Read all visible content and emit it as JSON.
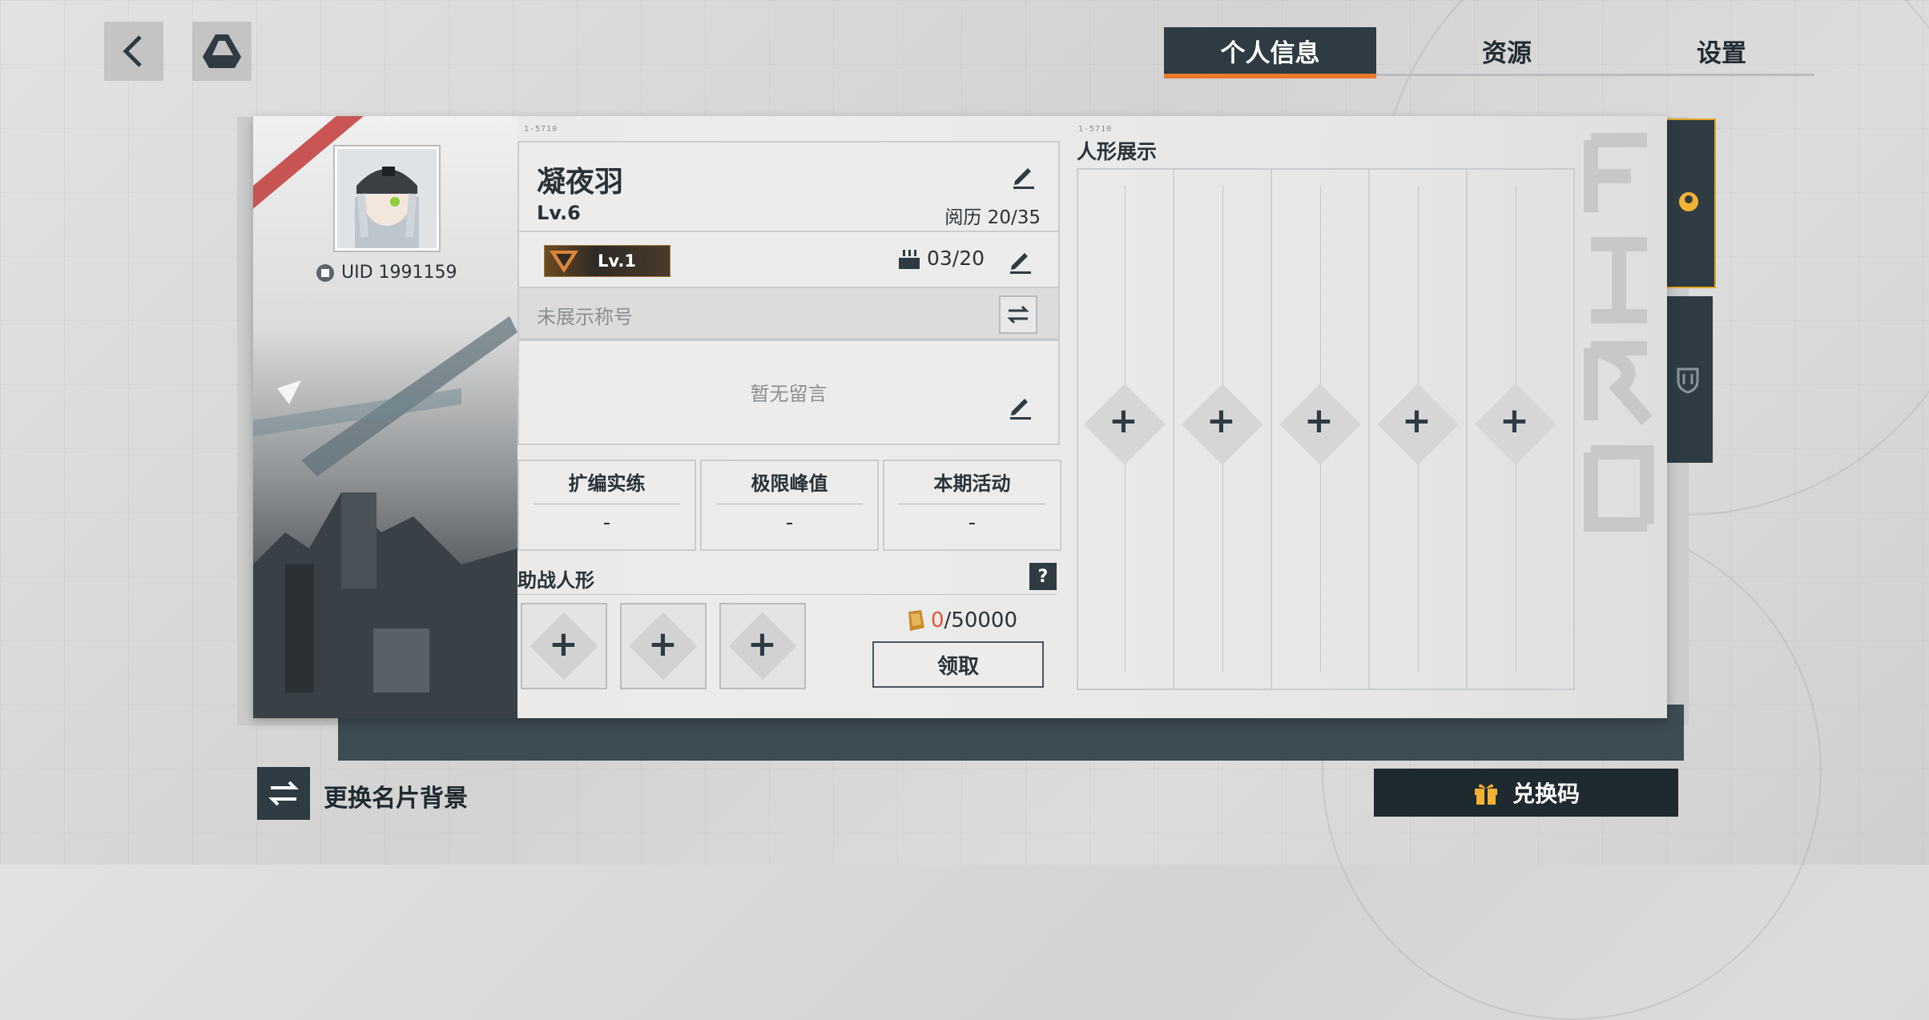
{
  "tabs": [
    {
      "label": "个人信息",
      "active": true
    },
    {
      "label": "资源",
      "active": false
    },
    {
      "label": "设置",
      "active": false
    }
  ],
  "profile": {
    "name": "凝夜羽",
    "level": "Lv.6",
    "experience": "阅历 20/35",
    "uid": "UID 1991159",
    "badge_level": "Lv.1",
    "cake_count": "03/20",
    "title_placeholder": "未展示称号",
    "message_placeholder": "暂无留言"
  },
  "stats": [
    {
      "label": "扩编实练",
      "value": "-"
    },
    {
      "label": "极限峰值",
      "value": "-"
    },
    {
      "label": "本期活动",
      "value": "-"
    }
  ],
  "support": {
    "title": "助战人形",
    "help": "?",
    "reward_current": "0",
    "reward_total": "/50000",
    "claim_label": "领取"
  },
  "display": {
    "title": "人形展示"
  },
  "bottom": {
    "change_bg_label": "更换名片背景",
    "redeem_label": "兑换码"
  },
  "colors": {
    "accent": "#e87a2c",
    "dark": "#2e3b43",
    "reward_red": "#e0553a"
  }
}
